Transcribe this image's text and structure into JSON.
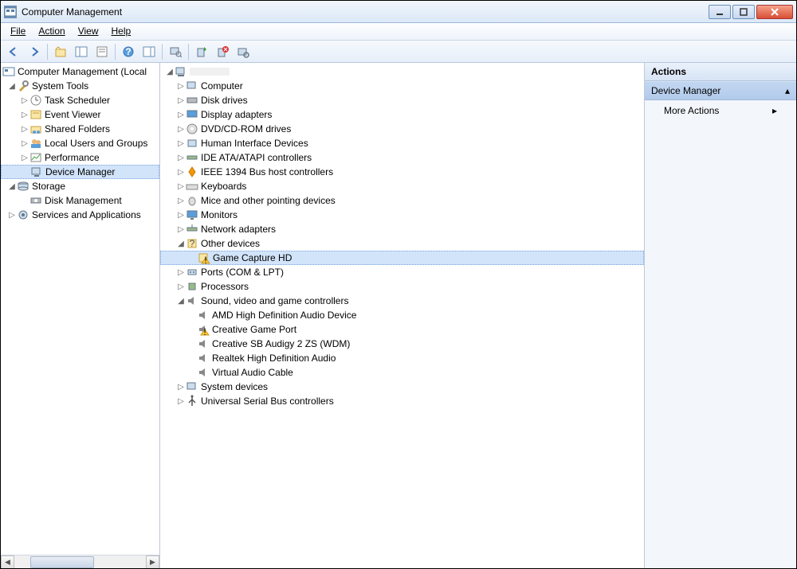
{
  "window": {
    "title": "Computer Management"
  },
  "menu": {
    "file": "File",
    "action": "Action",
    "view": "View",
    "help": "Help"
  },
  "leftTree": {
    "root": "Computer Management (Local",
    "systemTools": "System Tools",
    "taskScheduler": "Task Scheduler",
    "eventViewer": "Event Viewer",
    "sharedFolders": "Shared Folders",
    "localUsers": "Local Users and Groups",
    "performance": "Performance",
    "deviceManager": "Device Manager",
    "storage": "Storage",
    "diskMgmt": "Disk Management",
    "services": "Services and Applications"
  },
  "devTree": {
    "computer": "Computer",
    "diskDrives": "Disk drives",
    "display": "Display adapters",
    "dvd": "DVD/CD-ROM drives",
    "hid": "Human Interface Devices",
    "ide": "IDE ATA/ATAPI controllers",
    "ieee": "IEEE 1394 Bus host controllers",
    "keyboards": "Keyboards",
    "mice": "Mice and other pointing devices",
    "monitors": "Monitors",
    "network": "Network adapters",
    "other": "Other devices",
    "gameCapture": "Game Capture HD",
    "ports": "Ports (COM & LPT)",
    "processors": "Processors",
    "sound": "Sound, video and game controllers",
    "amd": "AMD High Definition Audio Device",
    "creativePort": "Creative Game Port",
    "creativeSB": "Creative SB Audigy 2 ZS (WDM)",
    "realtek": "Realtek High Definition Audio",
    "vac": "Virtual Audio Cable",
    "systemDev": "System devices",
    "usb": "Universal Serial Bus controllers"
  },
  "actions": {
    "header": "Actions",
    "section": "Device Manager",
    "more": "More Actions"
  }
}
